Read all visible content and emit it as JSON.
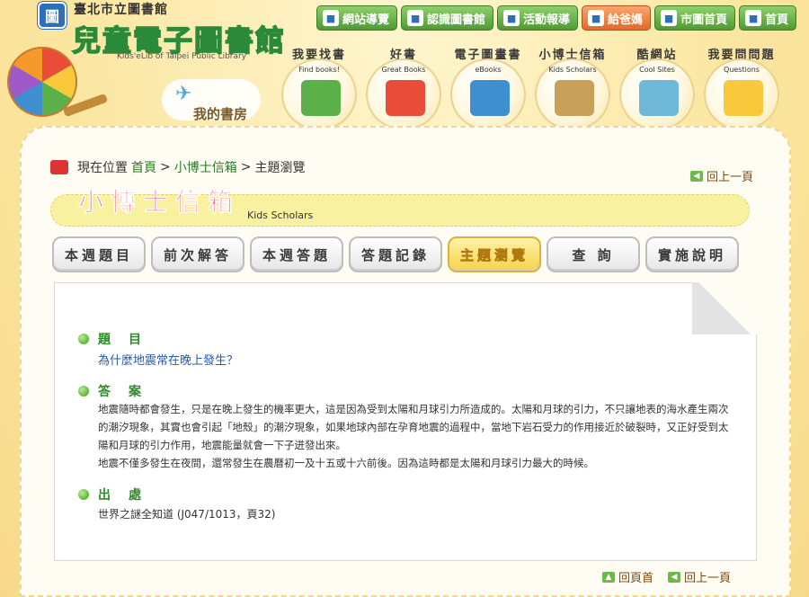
{
  "header": {
    "org": "臺北市立圖書館",
    "site_title": "兒童電子圖書館",
    "site_title_en": "Kids'eLib of Taipei Public Library",
    "my_books": "我的書房"
  },
  "top_nav": [
    {
      "label": "網站導覽",
      "icon": "sitemap-icon"
    },
    {
      "label": "認識圖書館",
      "icon": "library-icon"
    },
    {
      "label": "活動報導",
      "icon": "news-icon"
    },
    {
      "label": "給爸媽",
      "icon": "parents-icon"
    },
    {
      "label": "市圖首頁",
      "icon": "library-home-icon"
    },
    {
      "label": "首頁",
      "icon": "home-icon"
    }
  ],
  "circle_nav": [
    {
      "title": "我要找書",
      "en": "Find books!",
      "color": "#5bb04a"
    },
    {
      "title": "好書",
      "en": "Great Books",
      "color": "#e94d3a"
    },
    {
      "title": "電子圖畫書",
      "en": "eBooks",
      "color": "#3f8fd0"
    },
    {
      "title": "小博士信箱",
      "en": "Kids Scholars",
      "color": "#c9a05a"
    },
    {
      "title": "酷網站",
      "en": "Cool Sites",
      "color": "#6fb8d8"
    },
    {
      "title": "我要問問題",
      "en": "Questions",
      "color": "#f7c93b"
    }
  ],
  "breadcrumb": {
    "prefix": "現在位置",
    "home": "首頁",
    "section": "小博士信箱",
    "sep": ">",
    "current": "主題瀏覽"
  },
  "back_link": "回上一頁",
  "section_title": {
    "zh": "小博士信箱",
    "en": "Kids Scholars"
  },
  "tabs": [
    {
      "label": "本週題目",
      "active": false
    },
    {
      "label": "前次解答",
      "active": false
    },
    {
      "label": "本週答題",
      "active": false
    },
    {
      "label": "答題記錄",
      "active": false
    },
    {
      "label": "主題瀏覽",
      "active": true
    },
    {
      "label": "查 詢",
      "active": false
    },
    {
      "label": "實施說明",
      "active": false
    }
  ],
  "content": {
    "question_label": "題目",
    "question": "為什麼地震常在晚上發生？",
    "answer_label": "答案",
    "answer_p1": "地震隨時都會發生，只是在晚上發生的機率更大，這是因為受到太陽和月球引力所造成的。太陽和月球的引力，不只讓地表的海水產生兩次的潮汐現象，其實也會引起「地殼」的潮汐現象，如果地球內部在孕育地震的過程中，當地下岩石受力的作用接近於破裂時，又正好受到太陽和月球的引力作用，地震能量就會一下子迸發出來。",
    "answer_p2": "地震不僅多發生在夜間，還常發生在農曆初一及十五或十六前後。因為這時都是太陽和月球引力最大的時候。",
    "source_label": "出處",
    "source": "世界之謎全知道 (J047/1013，頁32)"
  },
  "bottom": {
    "top_link": "回頁首",
    "back_link": "回上一頁"
  }
}
